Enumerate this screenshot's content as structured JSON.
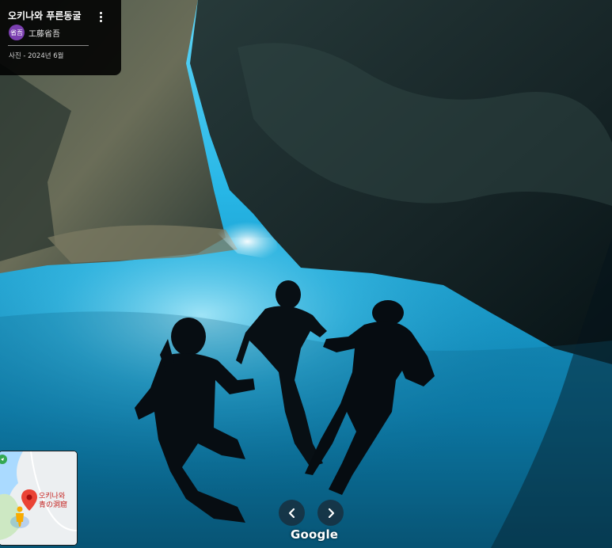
{
  "panorama": {
    "description_alt": "",
    "colors": {
      "water": "#39c6f0",
      "water_deep": "#0a6f9c",
      "cave_rock": "#17272c"
    }
  },
  "info_card": {
    "title": "오키나와 푸른동굴",
    "avatar_text": "省吾",
    "author": "工藤省吾",
    "date": "사진 - 2024년 6월",
    "more_icon": "more-vert-icon"
  },
  "mini_map": {
    "place_name_line1": "오키나와",
    "place_name_line2": "青の洞窟",
    "marker_icon": "map-pin-icon",
    "pegman_icon": "pegman-icon"
  },
  "navigation": {
    "back_icon": "chevron-left-icon",
    "forward_icon": "chevron-right-icon"
  },
  "branding": {
    "logo_text": "Google"
  }
}
